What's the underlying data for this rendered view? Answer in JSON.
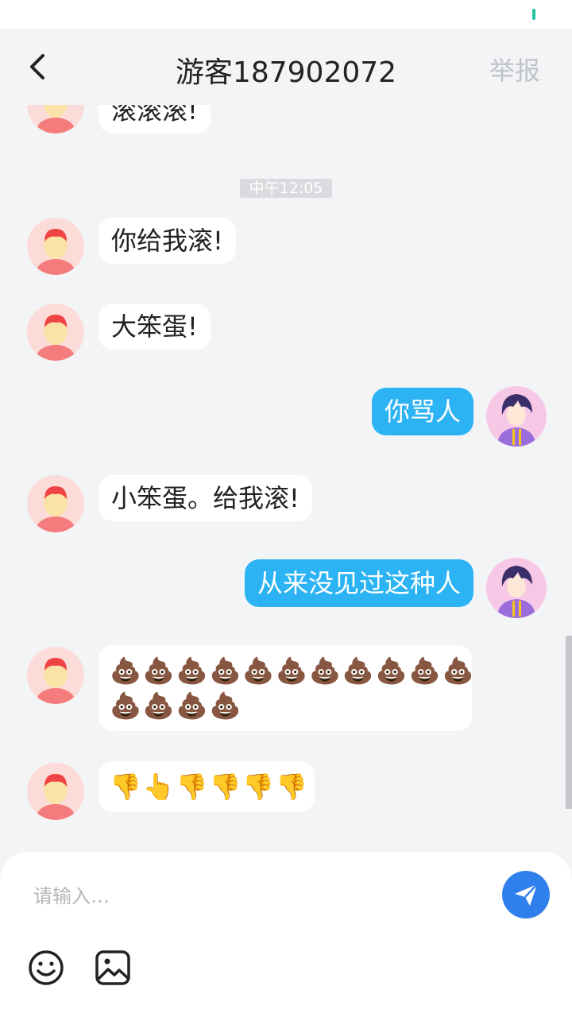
{
  "header": {
    "back_icon": "chevron-left-icon",
    "title": "游客187902072",
    "report_label": "举报"
  },
  "conversation": {
    "partial_top_text": "滚滚滚!",
    "timestamp": "中午12:05",
    "messages": [
      {
        "from": "other",
        "text": "你给我滚!"
      },
      {
        "from": "other",
        "text": "大笨蛋!"
      },
      {
        "from": "me",
        "text": "你骂人"
      },
      {
        "from": "other",
        "text": "小笨蛋。给我滚!"
      },
      {
        "from": "me",
        "text": "从来没见过这种人"
      },
      {
        "from": "other",
        "emoji_lines": [
          "💩💩💩💩💩💩💩💩💩💩💩",
          "💩💩💩💩"
        ]
      },
      {
        "from": "other",
        "emoji_lines": [
          "👎👆👎👎👎👎"
        ]
      }
    ]
  },
  "composer": {
    "placeholder": "请输入…",
    "send_icon": "paper-plane-icon",
    "emoji_icon": "smiley-icon",
    "image_icon": "image-icon"
  },
  "colors": {
    "accent_blue": "#2bb3f4",
    "send_button": "#2f80ed",
    "background": "#f3f4f6",
    "status_indicator": "#22c5a0"
  }
}
